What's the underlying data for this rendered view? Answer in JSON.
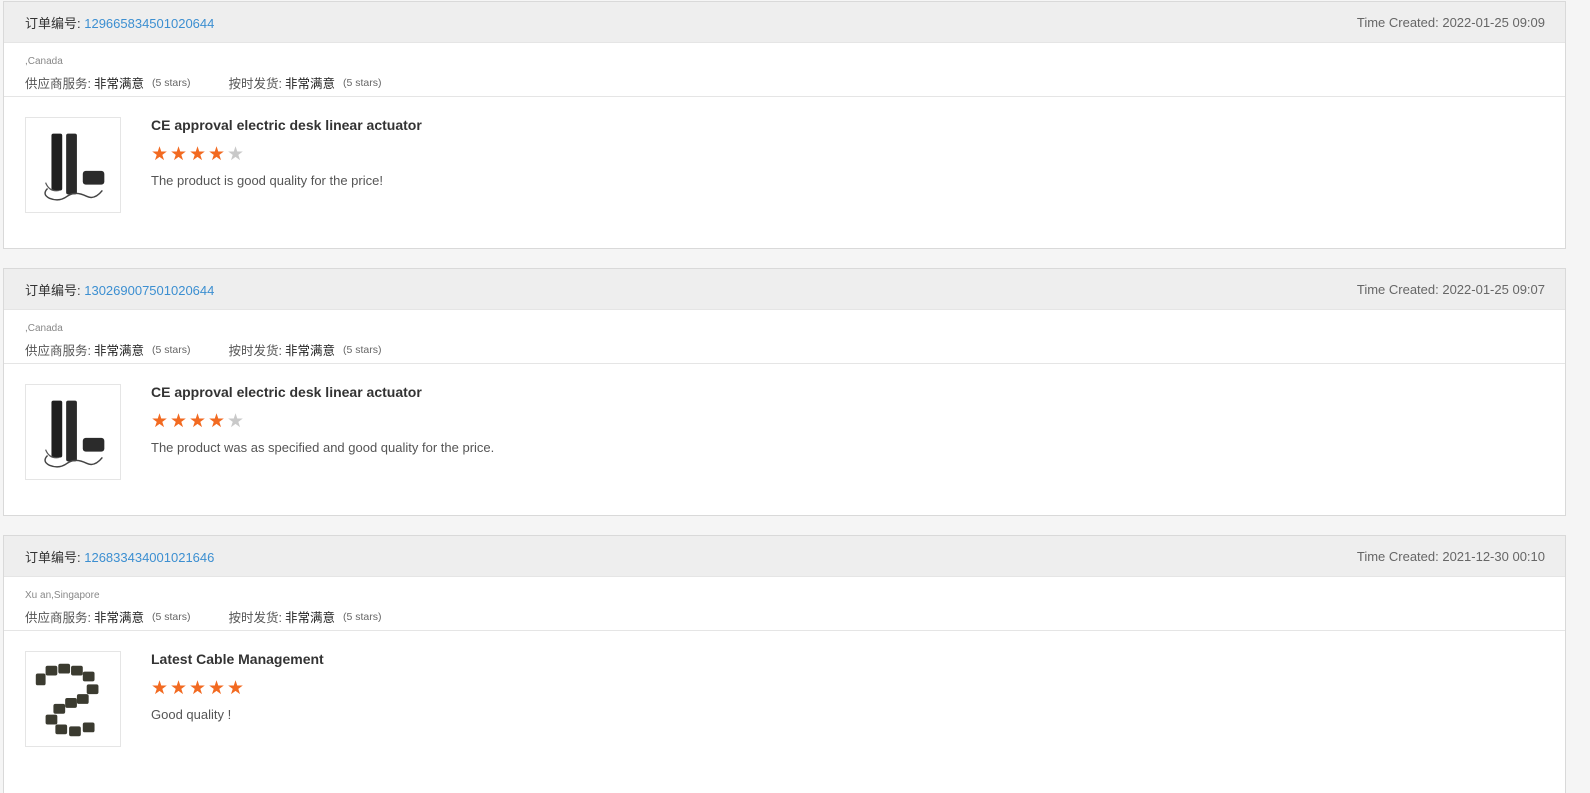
{
  "orders": [
    {
      "order_label": "订单编号: ",
      "order_no": "129665834501020644",
      "time_created": "Time Created: 2022-01-25 09:09",
      "location": ",Canada",
      "supplier_service_label": "供应商服务:",
      "supplier_service_value": "非常满意",
      "supplier_service_stars": "(5 stars)",
      "shipping_label": "按时发货:",
      "shipping_value": "非常满意",
      "shipping_stars": "(5 stars)",
      "product_title": "CE approval electric desk linear actuator",
      "rating": 4,
      "review": "The product is good quality for the price!",
      "thumb_icon": "linear-actuator-image"
    },
    {
      "order_label": "订单编号: ",
      "order_no": "130269007501020644",
      "time_created": "Time Created: 2022-01-25 09:07",
      "location": ",Canada",
      "supplier_service_label": "供应商服务:",
      "supplier_service_value": "非常满意",
      "supplier_service_stars": "(5 stars)",
      "shipping_label": "按时发货:",
      "shipping_value": "非常满意",
      "shipping_stars": "(5 stars)",
      "product_title": "CE approval electric desk linear actuator",
      "rating": 4,
      "review": "The product was as specified and good quality for the price.",
      "thumb_icon": "linear-actuator-image"
    },
    {
      "order_label": "订单编号: ",
      "order_no": "126833434001021646",
      "time_created": "Time Created: 2021-12-30 00:10",
      "location": "Xu an,Singapore",
      "supplier_service_label": "供应商服务:",
      "supplier_service_value": "非常满意",
      "supplier_service_stars": "(5 stars)",
      "shipping_label": "按时发货:",
      "shipping_value": "非常满意",
      "shipping_stars": "(5 stars)",
      "product_title": "Latest Cable Management",
      "rating": 5,
      "review": "Good quality !",
      "thumb_icon": "cable-management-image"
    }
  ],
  "colors": {
    "accent_link": "#3c8fd1",
    "star_on": "#f26a21",
    "star_off": "#c9c9c9"
  }
}
